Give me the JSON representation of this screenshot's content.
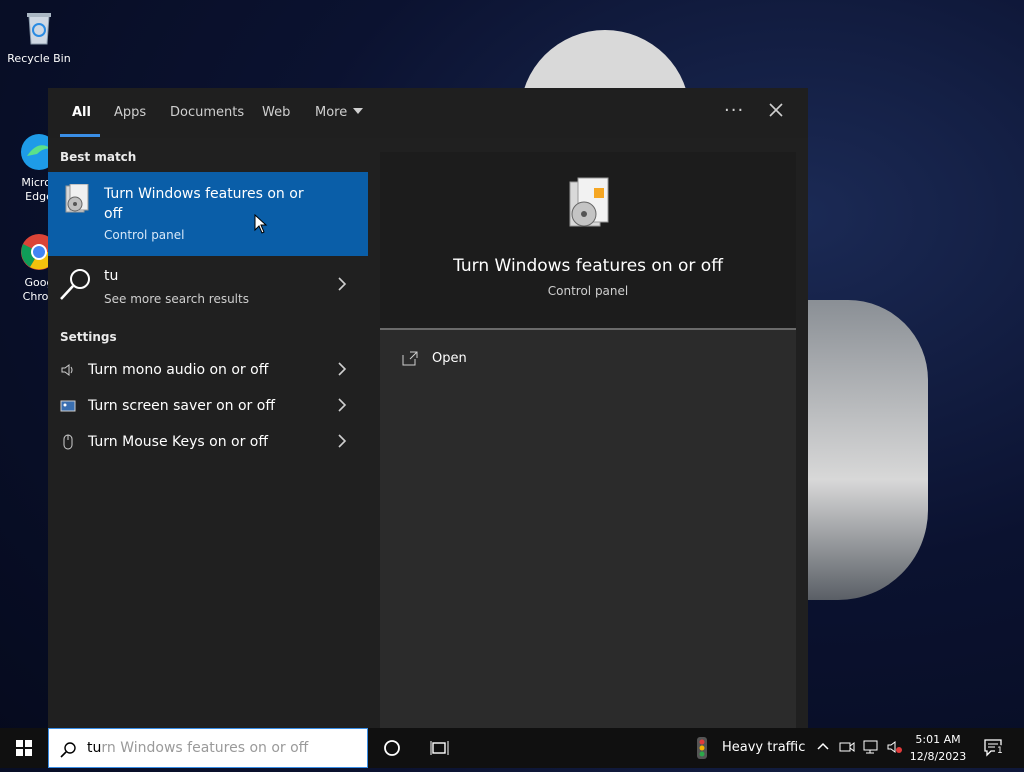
{
  "desktop": {
    "icons": [
      {
        "label": "Recycle Bin"
      },
      {
        "label": "Micros\nEdge"
      },
      {
        "label": "Goog\nChron"
      }
    ]
  },
  "search_panel": {
    "tabs": [
      {
        "label": "All",
        "active": true
      },
      {
        "label": "Apps"
      },
      {
        "label": "Documents"
      },
      {
        "label": "Web"
      },
      {
        "label": "More"
      }
    ],
    "more_options_label": "···",
    "best_match_heading": "Best match",
    "best_match": {
      "title": "Turn Windows features on or off",
      "subtitle": "Control panel"
    },
    "web_result": {
      "query": "tu",
      "subtitle": "See more search results"
    },
    "settings_heading": "Settings",
    "settings_items": [
      {
        "label": "Turn mono audio on or off",
        "icon": "speaker-icon"
      },
      {
        "label": "Turn screen saver on or off",
        "icon": "screen-saver-icon"
      },
      {
        "label": "Turn Mouse Keys on or off",
        "icon": "mouse-icon"
      }
    ],
    "preview": {
      "title": "Turn Windows features on or off",
      "subtitle": "Control panel",
      "action_open": "Open"
    }
  },
  "taskbar": {
    "search_typed": "tu",
    "search_completion": "rn Windows features on or off",
    "weather_text": "Heavy traffic",
    "time": "5:01 AM",
    "date": "12/8/2023",
    "notification_count": "1"
  },
  "colors": {
    "accent": "#0a5ea8",
    "panel_bg": "#202020",
    "taskbar_bg": "#101010"
  }
}
